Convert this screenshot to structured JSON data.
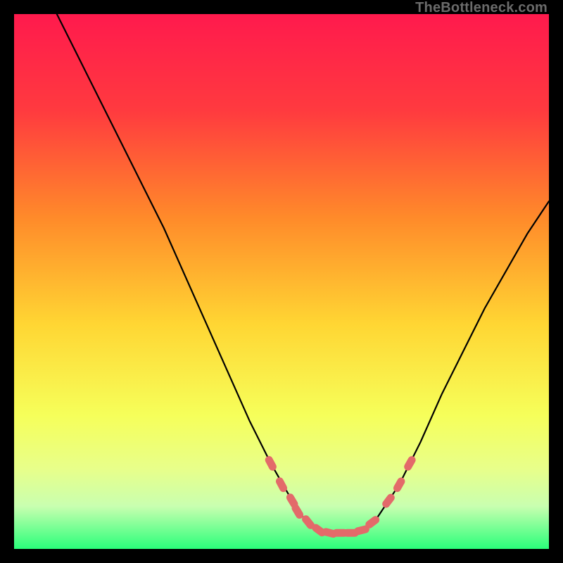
{
  "watermark": "TheBottleneck.com",
  "colors": {
    "gradient_top": "#ff1a4d",
    "gradient_mid_upper": "#ff6a33",
    "gradient_mid": "#ffd633",
    "gradient_lower": "#f4ff66",
    "gradient_pale": "#dcffb0",
    "gradient_bottom": "#2aff7a",
    "curve": "#000000",
    "marker": "#e36a6a",
    "frame_bg": "#000000"
  },
  "chart_data": {
    "type": "line",
    "title": "",
    "xlabel": "",
    "ylabel": "",
    "xlim": [
      0,
      100
    ],
    "ylim": [
      0,
      100
    ],
    "grid": false,
    "legend": false,
    "series": [
      {
        "name": "bottleneck-curve",
        "x": [
          8,
          12,
          16,
          20,
          24,
          28,
          32,
          36,
          40,
          44,
          48,
          52,
          54,
          56,
          58,
          60,
          62,
          64,
          66,
          68,
          72,
          76,
          80,
          84,
          88,
          92,
          96,
          100
        ],
        "y": [
          100,
          92,
          84,
          76,
          68,
          60,
          51,
          42,
          33,
          24,
          16,
          9,
          6,
          4,
          3,
          3,
          3,
          3,
          4,
          6,
          12,
          20,
          29,
          37,
          45,
          52,
          59,
          65
        ]
      }
    ],
    "markers": {
      "name": "highlighted-points",
      "points": [
        {
          "x": 48,
          "y": 16
        },
        {
          "x": 50,
          "y": 12
        },
        {
          "x": 52,
          "y": 9
        },
        {
          "x": 53,
          "y": 7
        },
        {
          "x": 55,
          "y": 5
        },
        {
          "x": 57,
          "y": 3.5
        },
        {
          "x": 59,
          "y": 3
        },
        {
          "x": 61,
          "y": 3
        },
        {
          "x": 63,
          "y": 3
        },
        {
          "x": 65,
          "y": 3.5
        },
        {
          "x": 67,
          "y": 5
        },
        {
          "x": 70,
          "y": 9
        },
        {
          "x": 72,
          "y": 12
        },
        {
          "x": 74,
          "y": 16
        }
      ]
    },
    "annotations": []
  }
}
